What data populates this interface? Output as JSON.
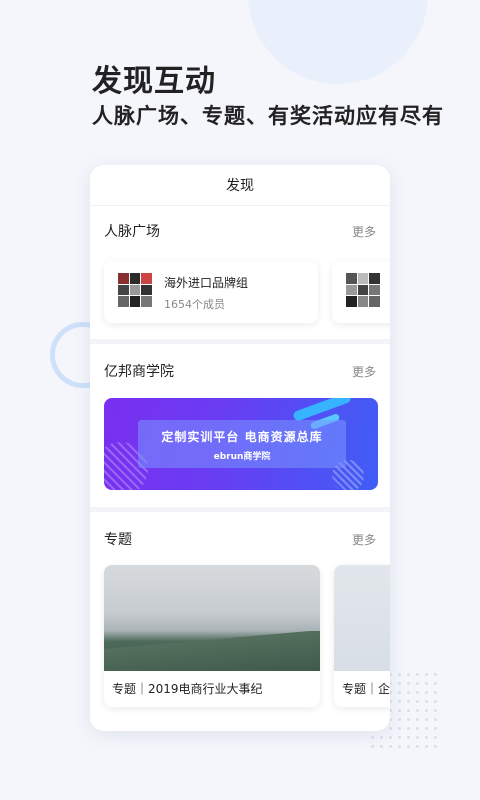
{
  "hero": {
    "title": "发现互动",
    "subtitle": "人脉广场、专题、有奖活动应有尽有"
  },
  "screen": {
    "header_title": "发现",
    "sections": {
      "network": {
        "title": "人脉广场",
        "more": "更多",
        "groups": [
          {
            "name": "海外进口品牌组",
            "members": "1654个成员"
          },
          {
            "name": "",
            "members": ""
          }
        ]
      },
      "academy": {
        "title": "亿邦商学院",
        "more": "更多",
        "banner_text": "定制实训平台  电商资源总库",
        "banner_brand": "ebrun商学院"
      },
      "topics": {
        "title": "专题",
        "more": "更多",
        "items": [
          {
            "caption": "专题｜2019电商行业大事纪"
          },
          {
            "caption": "专题｜企"
          }
        ]
      }
    }
  },
  "colors": {
    "accent_blue": "#3f5ef5",
    "accent_purple": "#7a2ff0",
    "text_primary": "#222222",
    "text_secondary": "#888888"
  }
}
